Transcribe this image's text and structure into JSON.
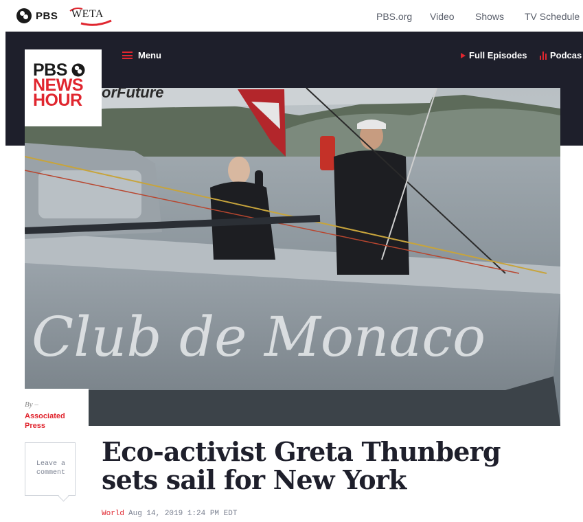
{
  "top_bar": {
    "pbs_logo_text": "PBS",
    "station_logo_text": "WETA",
    "nav": [
      "PBS.org",
      "Video",
      "Shows",
      "TV Schedule"
    ]
  },
  "main_nav": {
    "menu_label": "Menu",
    "full_episodes_label": "Full Episodes",
    "podcasts_label": "Podcas"
  },
  "brand_logo": {
    "line1": "PBS",
    "line2": "NEWS",
    "line3": "HOUR"
  },
  "hero_image": {
    "boat_banner_text": "orFuture",
    "hull_text": "Club de Monaco"
  },
  "byline": {
    "by_label": "By –",
    "author": "Associated Press",
    "comment_button": "Leave a comment"
  },
  "article": {
    "headline": "Eco-activist Greta Thunberg sets sail for New York",
    "category": "World",
    "date": "Aug 14, 2019 1:24 PM EDT"
  },
  "colors": {
    "accent": "#e0262f",
    "nav_dark": "#1e1f2b"
  }
}
